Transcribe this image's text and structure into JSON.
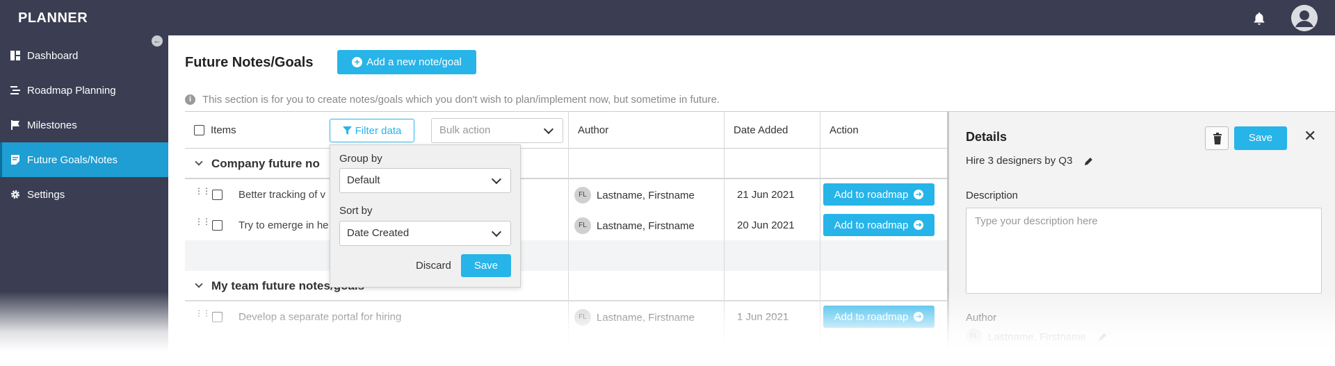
{
  "app": {
    "title": "PLANNER"
  },
  "topbar": {
    "bell_icon": "bell-icon",
    "avatar_icon": "user-avatar-icon"
  },
  "sidebar": {
    "items": [
      {
        "label": "Dashboard",
        "icon": "dashboard-icon",
        "active": false
      },
      {
        "label": "Roadmap Planning",
        "icon": "roadmap-icon",
        "active": false
      },
      {
        "label": "Milestones",
        "icon": "flag-icon",
        "active": false
      },
      {
        "label": "Future Goals/Notes",
        "icon": "notes-icon",
        "active": true
      },
      {
        "label": "Settings",
        "icon": "gear-icon",
        "active": false
      }
    ]
  },
  "page": {
    "title": "Future Notes/Goals",
    "add_button": "Add a new note/goal",
    "info": "This section is for you to create notes/goals which you don't wish to plan/implement now, but sometime in future."
  },
  "table": {
    "headers": {
      "items": "Items",
      "filter": "Filter data",
      "bulk_placeholder": "Bulk action",
      "author": "Author",
      "date_added": "Date Added",
      "action": "Action"
    },
    "groups": [
      {
        "title": "Company future no",
        "rows": [
          {
            "item": "Better tracking of v",
            "initials": "FL",
            "author": "Lastname, Firstname",
            "date": "21 Jun 2021",
            "action": "Add to roadmap"
          },
          {
            "item": "Try to emerge in he",
            "initials": "FL",
            "author": "Lastname, Firstname",
            "date": "20 Jun 2021",
            "action": "Add to roadmap"
          }
        ]
      },
      {
        "title": "My team future notes/goals",
        "rows": [
          {
            "item": "Develop a separate portal for hiring",
            "initials": "FL",
            "author": "Lastname, Firstname",
            "date": "1 Jun 2021",
            "action": "Add to roadmap"
          }
        ]
      }
    ]
  },
  "filter_popup": {
    "group_by_label": "Group by",
    "group_by_value": "Default",
    "sort_by_label": "Sort by",
    "sort_by_value": "Date Created",
    "discard": "Discard",
    "save": "Save"
  },
  "details": {
    "title": "Details",
    "save": "Save",
    "name": "Hire 3 designers by Q3",
    "description_label": "Description",
    "description_placeholder": "Type your description here",
    "author_label": "Author",
    "author_initials": "FL",
    "author_value": "Lastname, Firstname"
  },
  "colors": {
    "sidebar": "#3b3e52",
    "accent": "#27b4e8",
    "active_nav": "#1e9ed2"
  }
}
